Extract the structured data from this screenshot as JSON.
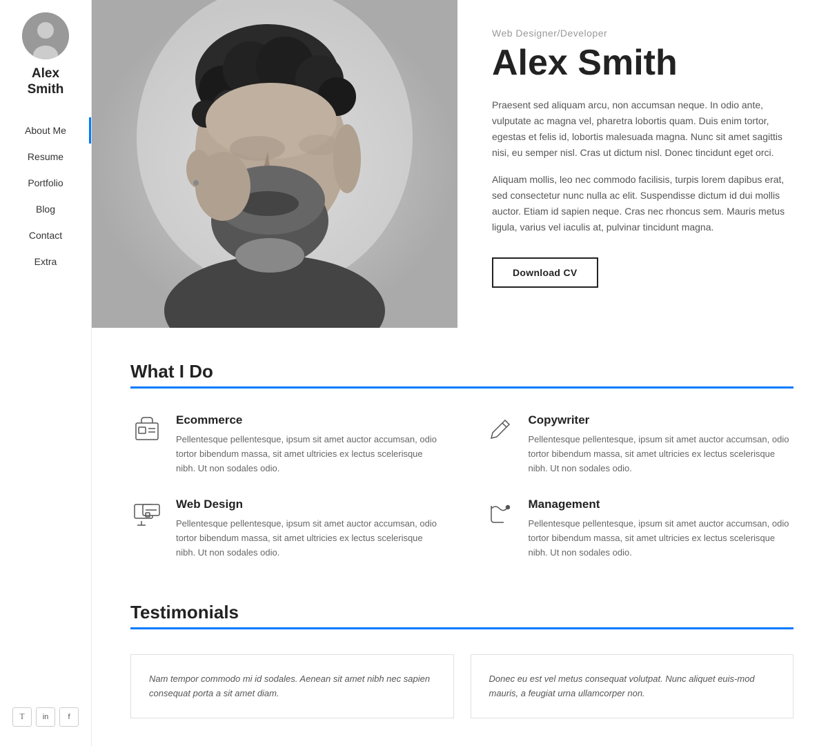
{
  "sidebar": {
    "name": "Alex\nSmith",
    "nav": [
      {
        "label": "About Me",
        "active": true
      },
      {
        "label": "Resume",
        "active": false
      },
      {
        "label": "Portfolio",
        "active": false
      },
      {
        "label": "Blog",
        "active": false
      },
      {
        "label": "Contact",
        "active": false
      },
      {
        "label": "Extra",
        "active": false
      }
    ],
    "social": [
      {
        "icon": "twitter",
        "label": "T"
      },
      {
        "icon": "linkedin",
        "label": "in"
      },
      {
        "icon": "facebook",
        "label": "f"
      }
    ]
  },
  "hero": {
    "subtitle": "Web Designer/Developer",
    "title": "Alex Smith",
    "desc1": "Praesent sed aliquam arcu, non accumsan neque. In odio ante, vulputate ac magna vel, pharetra lobortis quam. Duis enim tortor, egestas et felis id, lobortis malesuada magna. Nunc sit amet sagittis nisi, eu semper nisl. Cras ut dictum nisl. Donec tincidunt eget orci.",
    "desc2": "Aliquam mollis, leo nec commodo facilisis, turpis lorem dapibus erat, sed consectetur nunc nulla ac elit. Suspendisse dictum id dui mollis auctor. Etiam id sapien neque. Cras nec rhoncus sem. Mauris metus ligula, varius vel iaculis at, pulvinar tincidunt magna.",
    "download_btn": "Download CV"
  },
  "what_i_do": {
    "title": "What I Do",
    "services": [
      {
        "icon": "ecommerce",
        "title": "Ecommerce",
        "desc": "Pellentesque pellentesque, ipsum sit amet auctor accumsan, odio tortor bibendum massa, sit amet ultricies ex lectus scelerisque nibh. Ut non sodales odio."
      },
      {
        "icon": "copywriter",
        "title": "Copywriter",
        "desc": "Pellentesque pellentesque, ipsum sit amet auctor accumsan, odio tortor bibendum massa, sit amet ultricies ex lectus scelerisque nibh. Ut non sodales odio."
      },
      {
        "icon": "webdesign",
        "title": "Web Design",
        "desc": "Pellentesque pellentesque, ipsum sit amet auctor accumsan, odio tortor bibendum massa, sit amet ultricies ex lectus scelerisque nibh. Ut non sodales odio."
      },
      {
        "icon": "management",
        "title": "Management",
        "desc": "Pellentesque pellentesque, ipsum sit amet auctor accumsan, odio tortor bibendum massa, sit amet ultricies ex lectus scelerisque nibh. Ut non sodales odio."
      }
    ]
  },
  "testimonials": {
    "title": "Testimonials",
    "items": [
      {
        "text": "Nam tempor commodo mi id sodales. Aenean sit amet nibh nec sapien consequat porta a sit amet diam."
      },
      {
        "text": "Donec eu est vel metus consequat volutpat. Nunc aliquet euis-mod mauris, a feugiat urna ullamcorper non."
      }
    ]
  }
}
